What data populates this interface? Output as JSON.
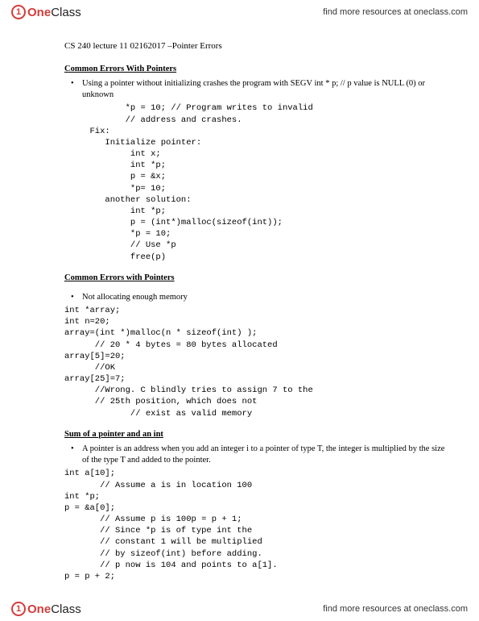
{
  "brand": {
    "icon": "1",
    "one": "One",
    "class": "Class"
  },
  "tagline": "find more resources at oneclass.com",
  "doc": {
    "title": "CS 240 lecture 11 02162017 –Pointer Errors",
    "sec1": "Common Errors With Pointers",
    "bullet1": "Using a pointer without initializing crashes the program with SEGV int * p; // p value is NULL (0) or unknown",
    "code1": "            *p = 10; // Program writes to invalid\n            // address and crashes.\n     Fix:\n        Initialize pointer:\n             int x;\n             int *p;\n             p = &x;\n             *p= 10;\n        another solution:\n             int *p;\n             p = (int*)malloc(sizeof(int));\n             *p = 10;\n             // Use *p\n             free(p)",
    "sec2": "Common Errors with Pointers",
    "bullet2": "Not allocating enough memory",
    "code2": "int *array;\nint n=20;\narray=(int *)malloc(n * sizeof(int) );\n      // 20 * 4 bytes = 80 bytes allocated\narray[5]=20;\n      //OK\narray[25]=7;\n      //Wrong. C blindly tries to assign 7 to the\n      // 25th position, which does not\n             // exist as valid memory",
    "sec3": "Sum of a pointer and an int",
    "bullet3": "A pointer is an address when you add an integer i to a pointer of type T, the integer is multiplied by the size of the type T and added to the pointer.",
    "code3": "int a[10];\n       // Assume a is in location 100\nint *p;\np = &a[0];\n       // Assume p is 100p = p + 1;\n       // Since *p is of type int the\n       // constant 1 will be multiplied\n       // by sizeof(int) before adding.\n       // p now is 104 and points to a[1].\np = p + 2;"
  }
}
